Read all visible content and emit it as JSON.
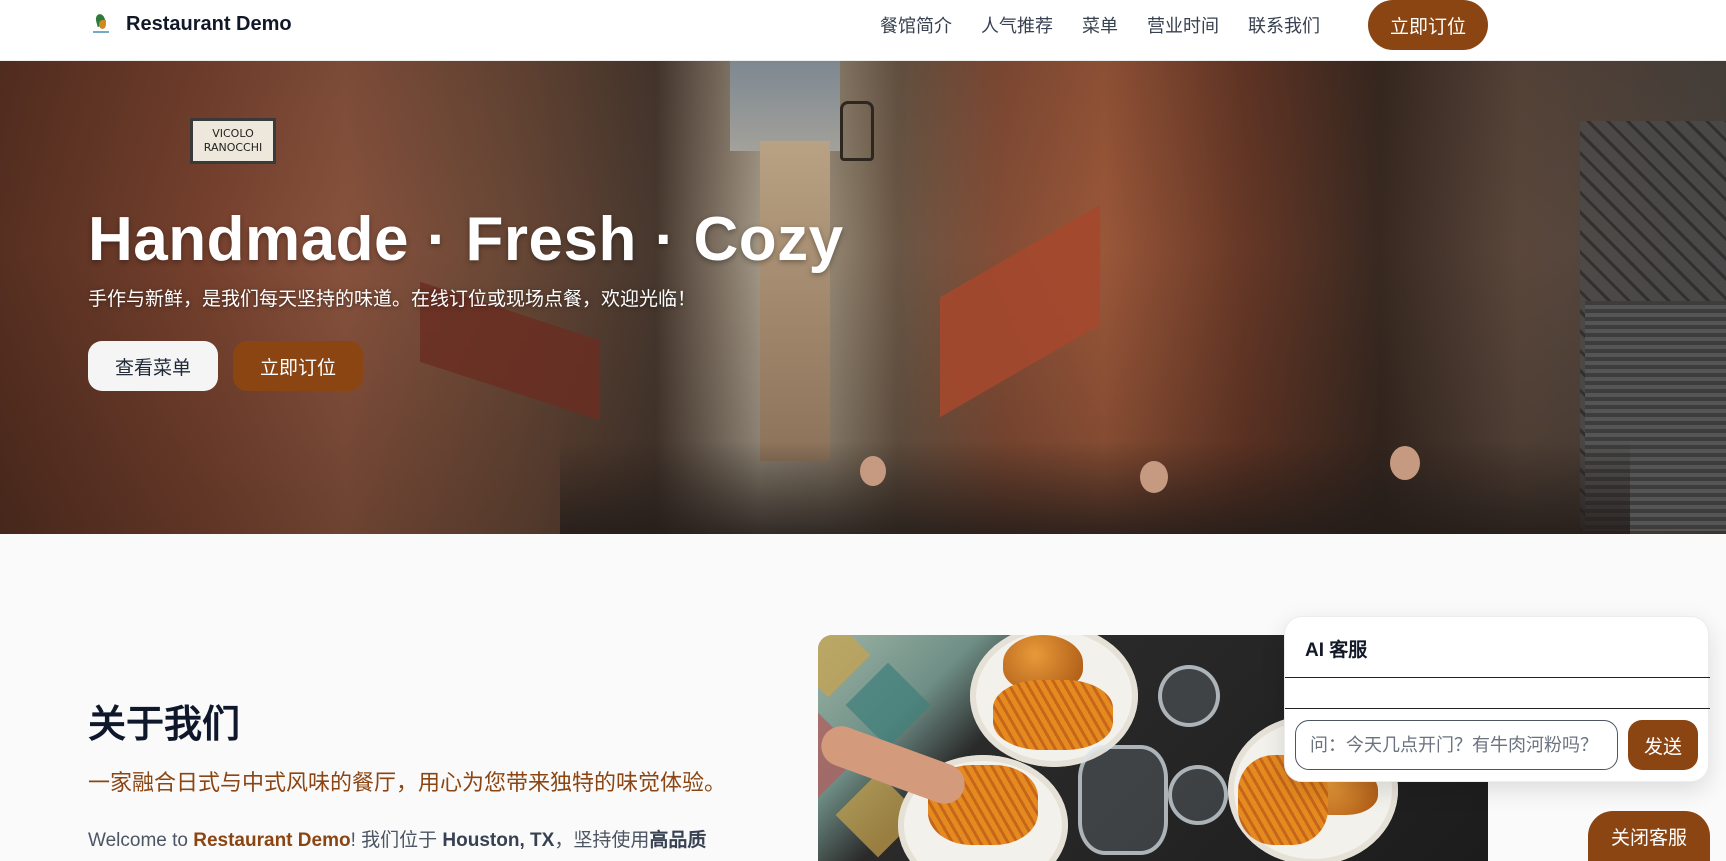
{
  "brand": {
    "name": "Restaurant Demo"
  },
  "nav": {
    "links": [
      "餐馆简介",
      "人气推荐",
      "菜单",
      "营业时间",
      "联系我们"
    ],
    "cta": "立即订位"
  },
  "hero": {
    "title": "Handmade · Fresh · Cozy",
    "subtitle": "手作与新鲜，是我们每天坚持的味道。在线订位或现场点餐，欢迎光临！",
    "menu_button": "查看菜单",
    "book_button": "立即订位",
    "street_sign": "VICOLO RANOCCHI"
  },
  "about": {
    "title": "关于我们",
    "tagline": "一家融合日式与中式风味的餐厅，用心为您带来独特的味觉体验。",
    "body_prefix": "Welcome to ",
    "body_brand": "Restaurant Demo",
    "body_mid": "! 我们位于 ",
    "body_location": "Houston, TX",
    "body_after": "，坚持使用",
    "body_quality": "高品质"
  },
  "chat": {
    "title": "AI 客服",
    "placeholder": "问：今天几点开门？有牛肉河粉吗？",
    "send": "发送",
    "close": "关闭客服"
  },
  "colors": {
    "accent": "#8b4513",
    "background": "#fafafa",
    "nav_bg": "#ffffff"
  }
}
